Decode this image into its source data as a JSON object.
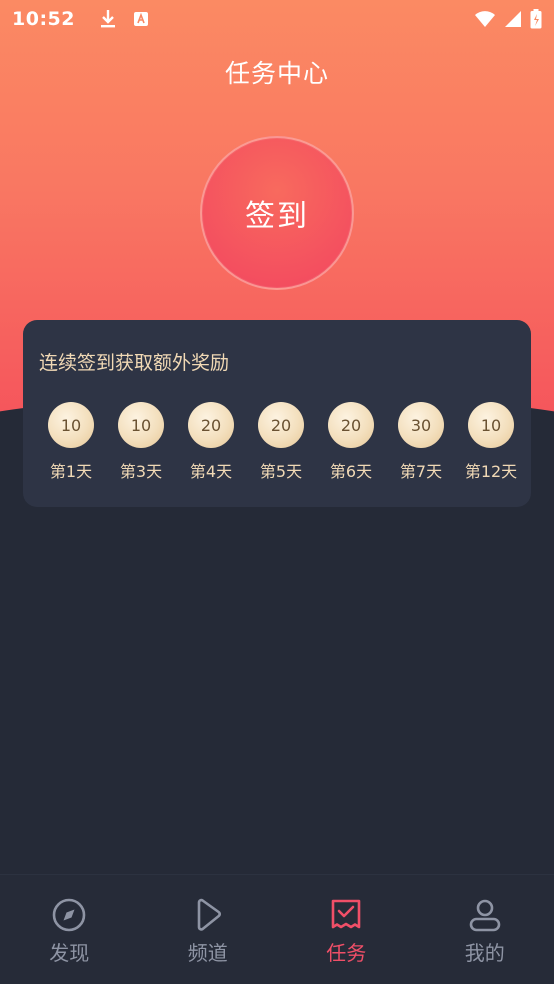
{
  "status_bar": {
    "time": "10:52"
  },
  "header": {
    "title": "任务中心"
  },
  "checkin": {
    "label": "签到"
  },
  "rewards": {
    "title": "连续签到获取额外奖励",
    "items": [
      {
        "amount": "10",
        "day": "第1天"
      },
      {
        "amount": "10",
        "day": "第3天"
      },
      {
        "amount": "20",
        "day": "第4天"
      },
      {
        "amount": "20",
        "day": "第5天"
      },
      {
        "amount": "20",
        "day": "第6天"
      },
      {
        "amount": "30",
        "day": "第7天"
      },
      {
        "amount": "10",
        "day": "第12天"
      }
    ]
  },
  "bottom_nav": {
    "items": [
      {
        "label": "发现",
        "icon": "compass-icon",
        "active": false
      },
      {
        "label": "频道",
        "icon": "play-icon",
        "active": false
      },
      {
        "label": "任务",
        "icon": "task-check-icon",
        "active": true
      },
      {
        "label": "我的",
        "icon": "user-icon",
        "active": false
      }
    ]
  },
  "colors": {
    "accent": "#f04f68",
    "gold_text": "#f1d9b5",
    "background": "#252a37"
  }
}
